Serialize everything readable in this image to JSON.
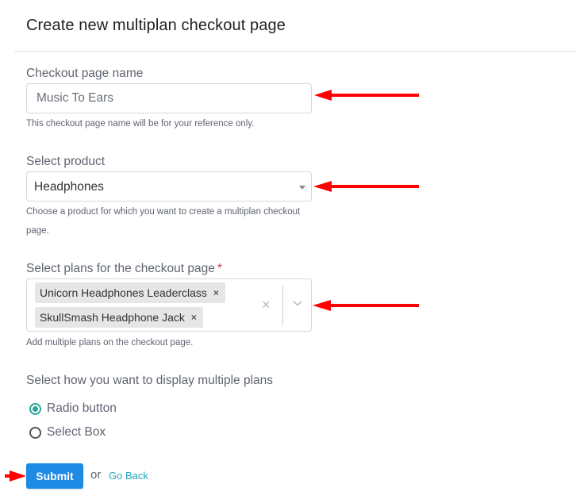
{
  "header": {
    "title": "Create new multiplan checkout page"
  },
  "form": {
    "checkout_name": {
      "label": "Checkout page name",
      "value": "Music To Ears",
      "help": "This checkout page name will be for your reference only."
    },
    "product": {
      "label": "Select product",
      "selected": "Headphones",
      "help": "Choose a product for which you want to create a multiplan checkout page."
    },
    "plans": {
      "label": "Select plans for the checkout page",
      "required_marker": "*",
      "selected": [
        {
          "label": "Unicorn Headphones Leaderclass",
          "remove": "×"
        },
        {
          "label": "SkullSmash Headphone Jack",
          "remove": "×"
        }
      ],
      "clear_all": "×",
      "help": "Add multiple plans on the checkout page."
    },
    "display_mode": {
      "label": "Select how you want to display multiple plans",
      "options": [
        {
          "label": "Radio button",
          "checked": true
        },
        {
          "label": "Select Box",
          "checked": false
        }
      ]
    }
  },
  "actions": {
    "submit_label": "Submit",
    "or_text": "or",
    "go_back_label": "Go Back"
  },
  "colors": {
    "primary": "#1e8ae3",
    "radio_accent": "#2aa69a",
    "link": "#22a6c0",
    "annotation_arrow": "#ff0000",
    "required": "#d0324a"
  }
}
